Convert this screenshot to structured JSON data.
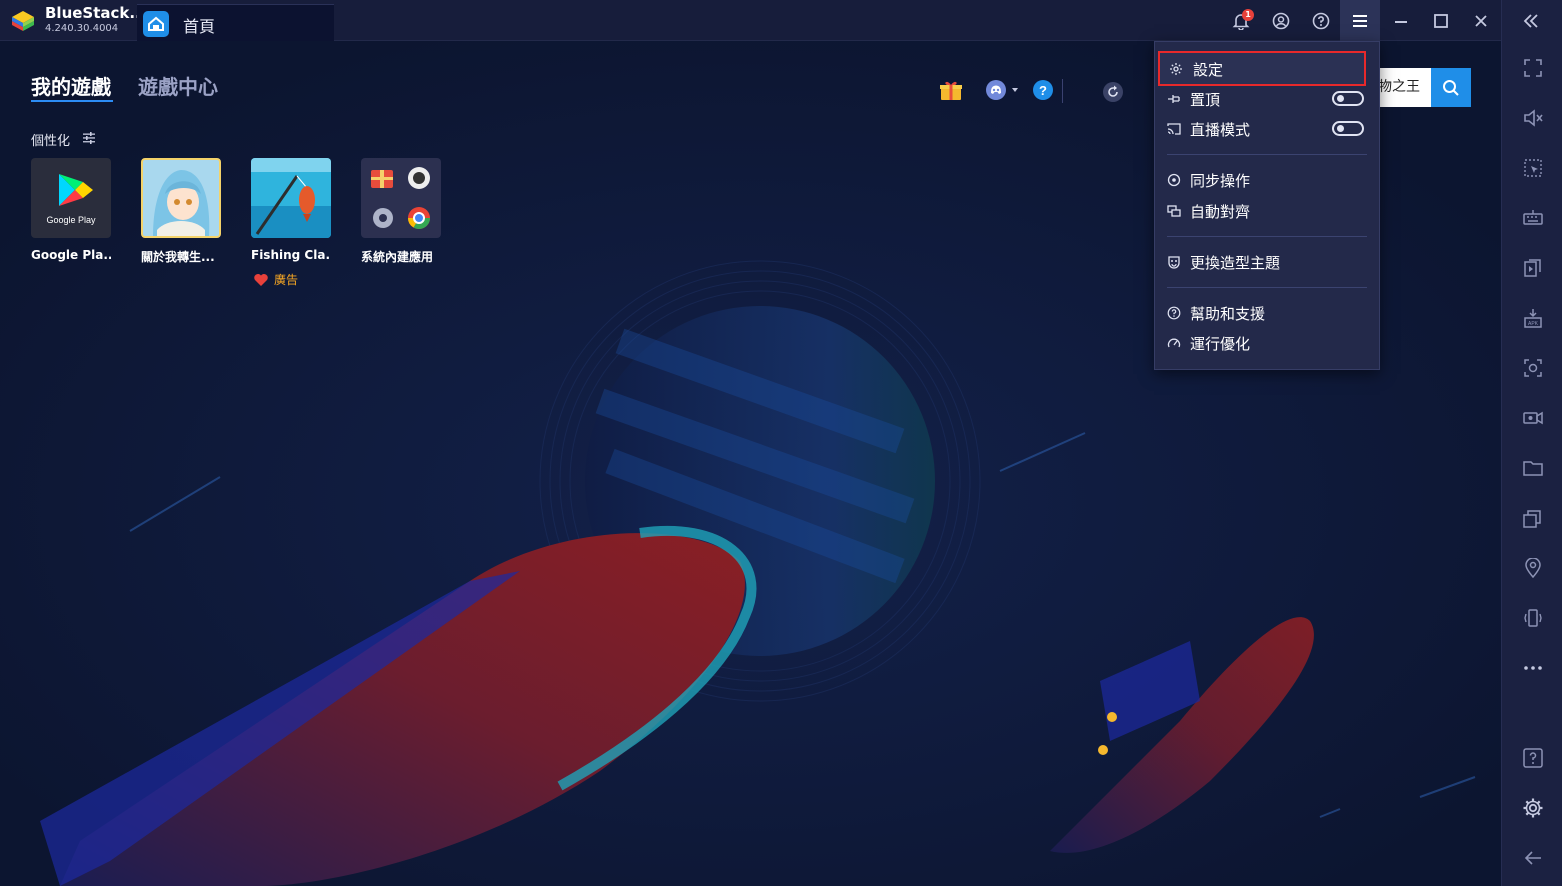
{
  "app": {
    "name": "BlueStack...",
    "version": "4.240.30.4004"
  },
  "tab": {
    "label": "首頁"
  },
  "titlebar": {
    "notification_count": "1"
  },
  "nav": {
    "tabs": [
      {
        "label": "我的遊戲",
        "active": true
      },
      {
        "label": "遊戲中心",
        "active": false
      }
    ]
  },
  "section": {
    "label": "個性化"
  },
  "apps": [
    {
      "label": "Google Pla...",
      "tile_text": "Google Play"
    },
    {
      "label": "關於我轉生..."
    },
    {
      "label": "Fishing Cla..."
    },
    {
      "label": "系統內建應用"
    }
  ],
  "ad": {
    "label": "廣告"
  },
  "search": {
    "value": "物之王"
  },
  "menu": {
    "items": [
      {
        "label": "設定",
        "icon": "gear-icon"
      },
      {
        "label": "置頂",
        "icon": "pin-icon",
        "toggle": false
      },
      {
        "label": "直播模式",
        "icon": "cast-icon",
        "toggle": false
      },
      {
        "label": "同步操作",
        "icon": "sync-icon"
      },
      {
        "label": "自動對齊",
        "icon": "align-icon"
      },
      {
        "label": "更換造型主題",
        "icon": "theme-icon"
      },
      {
        "label": "幫助和支援",
        "icon": "help-icon"
      },
      {
        "label": "運行優化",
        "icon": "speed-icon"
      }
    ]
  },
  "colors": {
    "accent": "#1f8ee8",
    "background": "#0d1733",
    "highlight_border": "#e8292b",
    "ad": "#f5a623"
  }
}
